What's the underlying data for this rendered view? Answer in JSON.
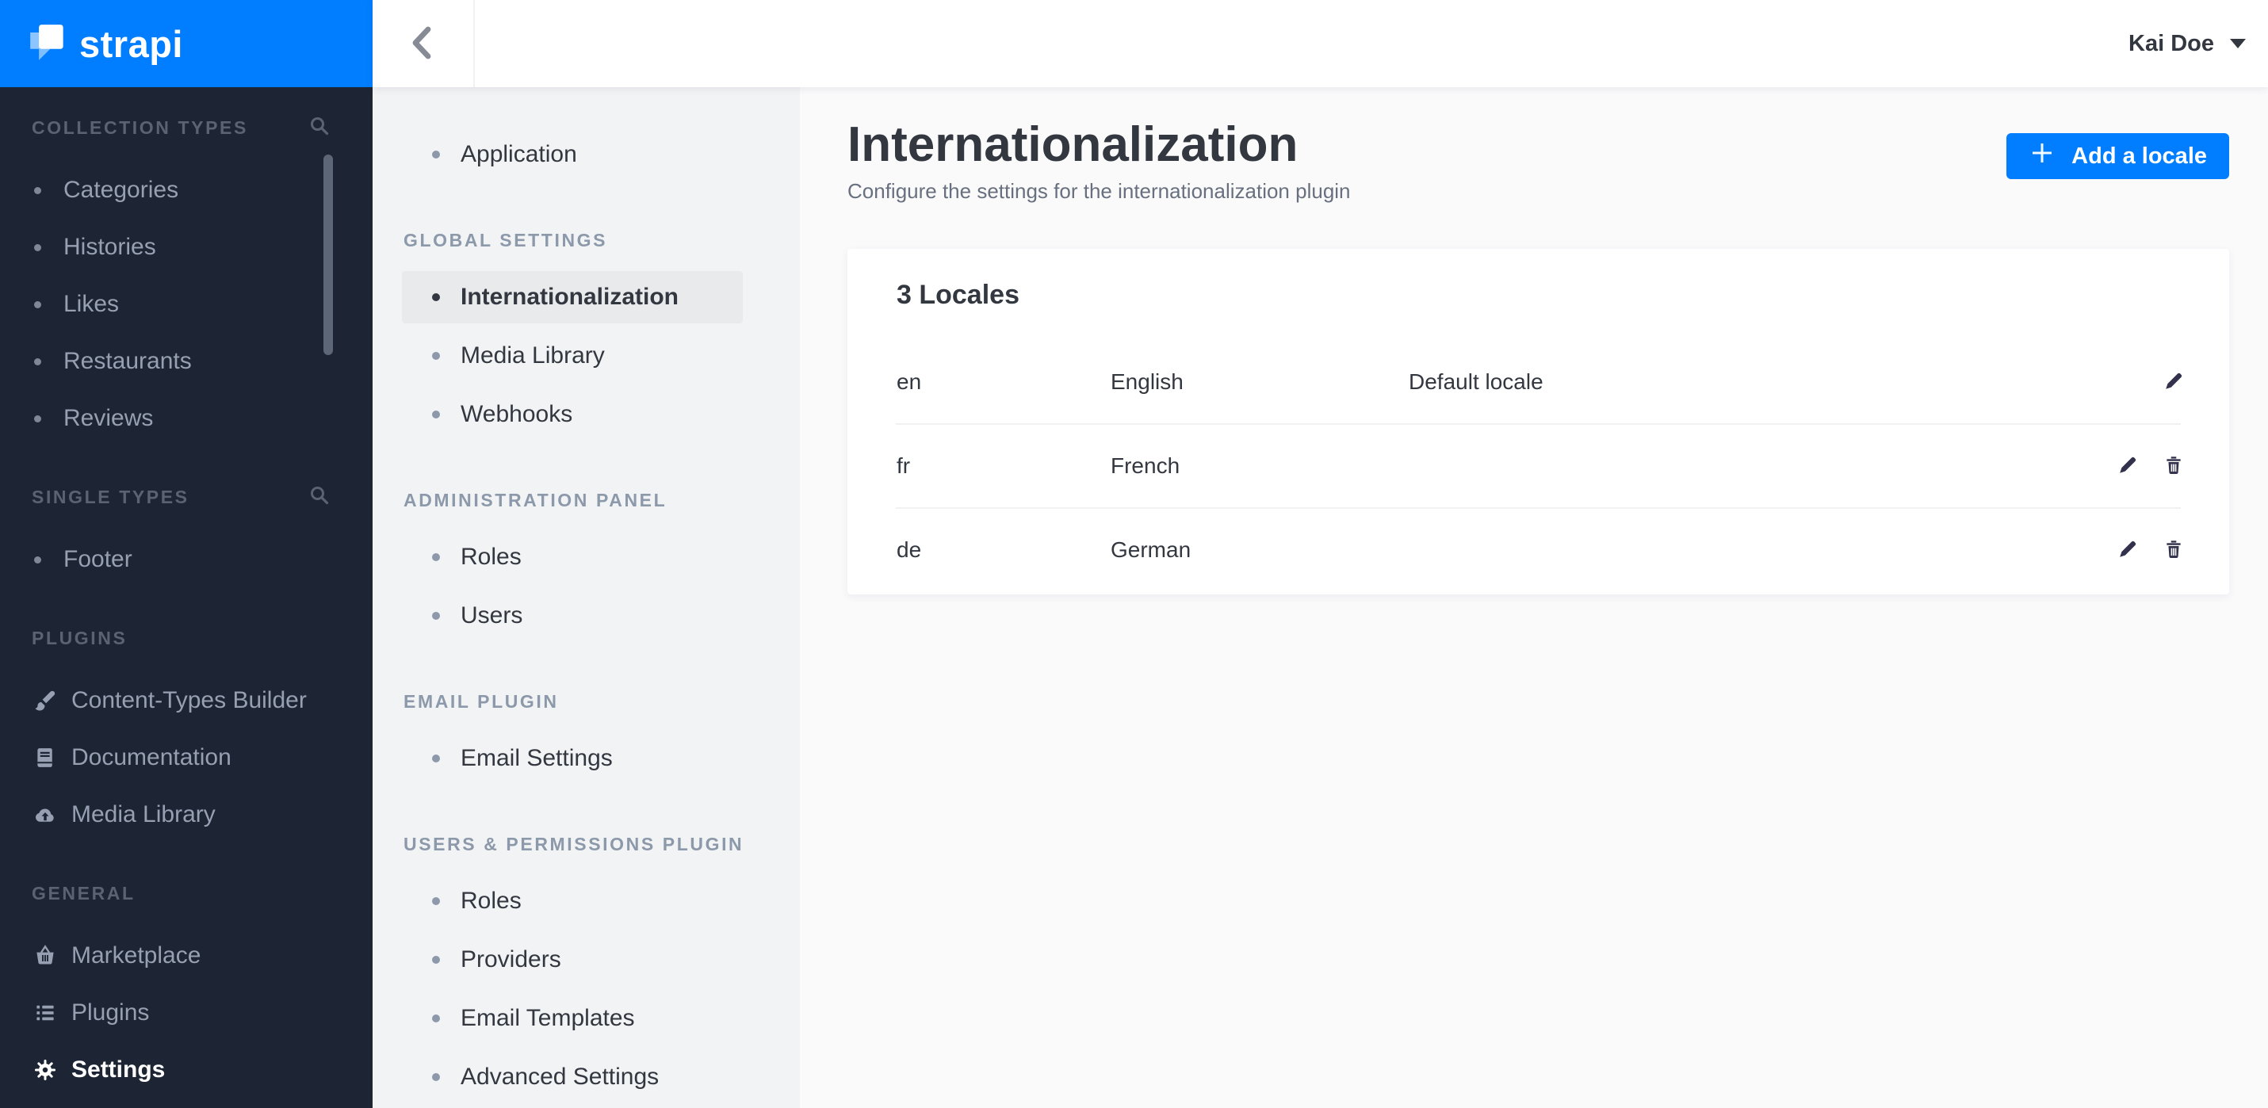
{
  "brand": {
    "name": "strapi"
  },
  "nav": {
    "sections": [
      {
        "label": "COLLECTION TYPES",
        "has_search": true,
        "items": [
          {
            "label": "Categories"
          },
          {
            "label": "Histories"
          },
          {
            "label": "Likes"
          },
          {
            "label": "Restaurants"
          },
          {
            "label": "Reviews"
          }
        ]
      },
      {
        "label": "SINGLE TYPES",
        "has_search": true,
        "items": [
          {
            "label": "Footer"
          }
        ]
      },
      {
        "label": "PLUGINS",
        "has_search": false,
        "items": [
          {
            "label": "Content-Types Builder",
            "icon": "paintbrush-icon"
          },
          {
            "label": "Documentation",
            "icon": "book-icon"
          },
          {
            "label": "Media Library",
            "icon": "cloud-upload-icon"
          }
        ]
      },
      {
        "label": "GENERAL",
        "has_search": false,
        "items": [
          {
            "label": "Marketplace",
            "icon": "basket-icon"
          },
          {
            "label": "Plugins",
            "icon": "list-icon"
          },
          {
            "label": "Settings",
            "icon": "gear-icon",
            "active": true
          }
        ]
      }
    ]
  },
  "topbar": {
    "user_name": "Kai Doe"
  },
  "settings_menu": {
    "top_items": [
      {
        "label": "Application"
      }
    ],
    "groups": [
      {
        "label": "GLOBAL SETTINGS",
        "items": [
          {
            "label": "Internationalization",
            "active": true
          },
          {
            "label": "Media Library"
          },
          {
            "label": "Webhooks"
          }
        ]
      },
      {
        "label": "ADMINISTRATION PANEL",
        "items": [
          {
            "label": "Roles"
          },
          {
            "label": "Users"
          }
        ]
      },
      {
        "label": "EMAIL PLUGIN",
        "items": [
          {
            "label": "Email Settings"
          }
        ]
      },
      {
        "label": "USERS & PERMISSIONS PLUGIN",
        "items": [
          {
            "label": "Roles"
          },
          {
            "label": "Providers"
          },
          {
            "label": "Email Templates"
          },
          {
            "label": "Advanced Settings"
          }
        ]
      }
    ]
  },
  "page": {
    "title": "Internationalization",
    "subtitle": "Configure the settings for the internationalization plugin",
    "add_locale_button": "Add a locale"
  },
  "locales": {
    "heading": "3 Locales",
    "rows": [
      {
        "code": "en",
        "name": "English",
        "note": "Default locale"
      },
      {
        "code": "fr",
        "name": "French",
        "note": ""
      },
      {
        "code": "de",
        "name": "German",
        "note": ""
      }
    ]
  },
  "colors": {
    "brand_blue": "#007eff",
    "sidebar_dark": "#1d2433",
    "active_item_bg": "#e9eaec",
    "settings_sidebar_bg": "#f2f3f4",
    "main_bg": "#fafafb",
    "text_dark": "#333740",
    "muted_text": "#68707f",
    "icon_dark": "#32324d"
  }
}
